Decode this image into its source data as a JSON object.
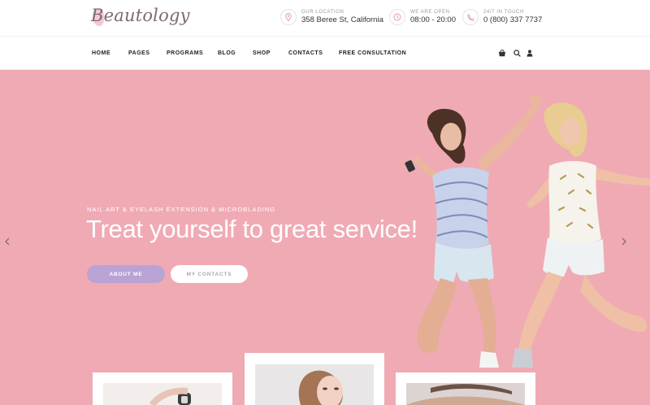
{
  "brand": {
    "name": "Beautology"
  },
  "header": {
    "location": {
      "caption": "OUR LOCATION",
      "value": "358 Beree St, California",
      "icon": "map-pin-icon"
    },
    "hours": {
      "caption": "WE ARE OPEN",
      "value": "08:00 - 20:00",
      "icon": "clock-icon"
    },
    "contact": {
      "caption": "24/7 IN TOUCH",
      "value": "0 (800) 337 7737",
      "icon": "phone-icon"
    }
  },
  "nav": {
    "items": [
      {
        "label": "HOME"
      },
      {
        "label": "PAGES"
      },
      {
        "label": "PROGRAMS"
      },
      {
        "label": "BLOG"
      },
      {
        "label": "SHOP"
      },
      {
        "label": "CONTACTS"
      },
      {
        "label": "FREE CONSULTATION"
      }
    ],
    "icons": [
      "cart-icon",
      "search-icon",
      "user-icon"
    ]
  },
  "hero": {
    "subtitle": "NAIL ART & EYELASH EXTENSION & MICROBLADING",
    "title": "Treat yourself to great service!",
    "primary_button": "ABOUT ME",
    "secondary_button": "MY CONTACTS"
  },
  "colors": {
    "hero_bg": "#f0aab4",
    "accent": "#b8a3d4",
    "icon_pink": "#e39aae"
  }
}
